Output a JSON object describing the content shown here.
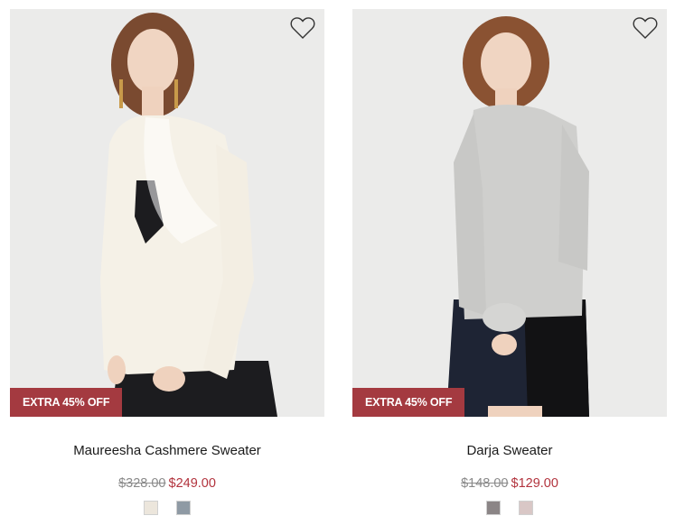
{
  "products": [
    {
      "badge": "EXTRA 45% OFF",
      "name": "Maureesha Cashmere Sweater",
      "original_price": "$328.00",
      "sale_price": "$249.00",
      "swatch_colors": [
        "#ece6dc",
        "#8f9aa4"
      ],
      "garment_color": "#f5f1e7"
    },
    {
      "badge": "EXTRA 45% OFF",
      "name": "Darja Sweater",
      "original_price": "$148.00",
      "sale_price": "$129.00",
      "swatch_colors": [
        "#8b8586",
        "#d9c7c6"
      ],
      "garment_color": "#cfcfcd"
    }
  ],
  "colors": {
    "badge_bg": "#a43a40",
    "sale_price": "#b2333d",
    "original_price": "#8a8a8a"
  },
  "icons": {
    "wishlist": "heart-outline-icon"
  }
}
